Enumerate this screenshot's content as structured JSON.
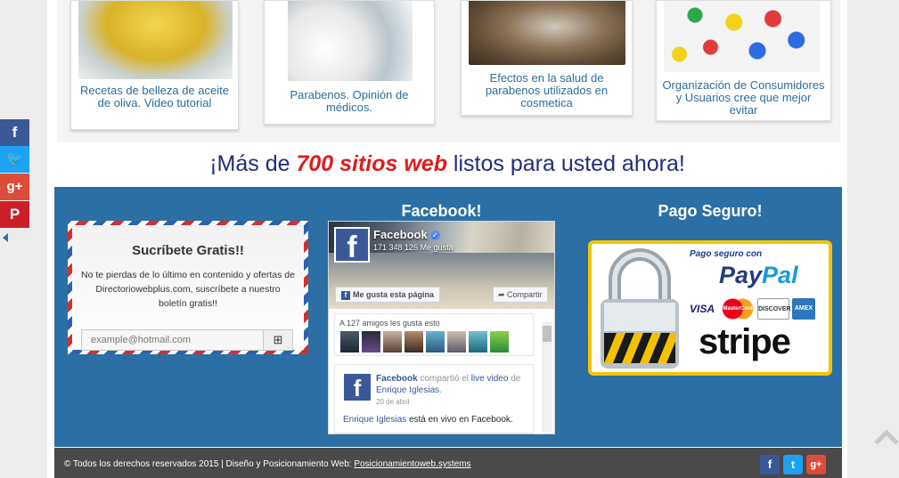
{
  "articles": [
    {
      "title": "Recetas de belleza de aceite de oliva. Video tutorial",
      "image": "olive-oil-bowl"
    },
    {
      "title": "Parabenos. Opinión de médicos.",
      "image": "cotton-and-bottle"
    },
    {
      "title": "Efectos en la salud de parabenos utilizados en cosmetica",
      "image": "eggs-in-nest"
    },
    {
      "title": "Organización de Consumidores y Usuarios cree que mejor evitar",
      "image": "colored-shapes"
    }
  ],
  "headline": {
    "pre": "¡Más de ",
    "highlight": "700 sitios web",
    "post": " listos para usted ahora!"
  },
  "newsletter": {
    "title": "Sucríbete Gratis!!",
    "text": "No te pierdas de lo último en contenido y ofertas de Directoriowebplus.com, suscríbete a nuestro boletín gratis!!",
    "placeholder": "example@hotmail.com",
    "button_icon": "plus-icon"
  },
  "facebook": {
    "widget_title": "Facebook!",
    "page_name": "Facebook",
    "likes": "171 348 126 Me gusta",
    "like_button": "Me gusta esta página",
    "share_button": "Compartir",
    "friends_label": "A 127 amigos les gusta esto",
    "post": {
      "author": "Facebook",
      "action": "compartió el",
      "link": "live video",
      "prep": "de",
      "source": "Enrique Iglesias",
      "date": "20 de abril",
      "body_link": "Enrique Iglesias",
      "body_rest": "está en vivo en Facebook."
    }
  },
  "payment": {
    "widget_title": "Pago Seguro!",
    "heading": "Pago seguro con",
    "paypal_a": "Pay",
    "paypal_b": "Pal",
    "cards": [
      "VISA",
      "MasterCard",
      "DISCOVER",
      "AMEX"
    ],
    "stripe": "stripe"
  },
  "footer": {
    "copyright": "© Todos los derechos reservados 2015 | Diseño y Posicionamiento Web: ",
    "link": "Posicionamientoweb.systems",
    "social": [
      "facebook-icon",
      "twitter-icon",
      "google-plus-icon"
    ]
  },
  "share_bar": [
    "facebook-icon",
    "twitter-icon",
    "google-plus-icon",
    "pinterest-icon"
  ],
  "colors": {
    "brand_blue": "#2b6fa5",
    "headline": "#1f2e7a",
    "highlight": "#e01c1c",
    "facebook": "#3b5998"
  }
}
